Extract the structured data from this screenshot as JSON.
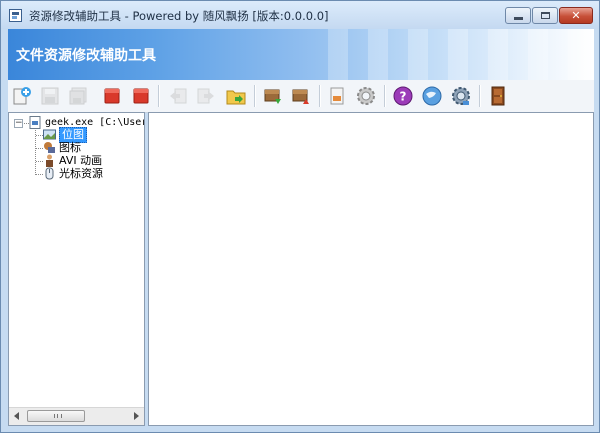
{
  "window": {
    "title": "资源修改辅助工具 - Powered by 随风飘扬 [版本:0.0.0.0]",
    "close_symbol": "✕"
  },
  "banner": {
    "title": "文件资源修改辅助工具"
  },
  "toolbar": {
    "buttons": [
      {
        "icon": "new-file-icon",
        "enabled": true
      },
      {
        "icon": "save-icon",
        "enabled": false
      },
      {
        "icon": "save-as-icon",
        "enabled": false
      },
      {
        "icon": "red-block-icon",
        "enabled": true
      },
      {
        "icon": "red-block-icon",
        "enabled": true
      },
      {
        "icon": "import-icon",
        "enabled": false
      },
      {
        "icon": "export-icon",
        "enabled": false
      },
      {
        "icon": "open-folder-icon",
        "enabled": true
      },
      {
        "icon": "extract-box-icon",
        "enabled": true
      },
      {
        "icon": "insert-box-icon",
        "enabled": true
      },
      {
        "icon": "document-icon",
        "enabled": true
      },
      {
        "icon": "settings-gear-icon",
        "enabled": true
      },
      {
        "icon": "help-icon",
        "enabled": true
      },
      {
        "icon": "web-globe-icon",
        "enabled": true
      },
      {
        "icon": "update-gear-icon",
        "enabled": true
      },
      {
        "icon": "exit-door-icon",
        "enabled": true
      }
    ]
  },
  "tree": {
    "root": {
      "expander": "−",
      "label": "geek.exe [C:\\Users\\i"
    },
    "children": [
      {
        "label": "位图",
        "selected": true,
        "icon": "bitmap-icon"
      },
      {
        "label": "图标",
        "icon": "icon-resource-icon"
      },
      {
        "label": "AVI 动画",
        "icon": "avi-animation-icon"
      },
      {
        "label": "光标资源",
        "icon": "cursor-resource-icon"
      }
    ]
  },
  "colors": {
    "selection": "#3399ff",
    "banner_start": "#3a86da",
    "window_frame": "#c6dbf1"
  }
}
